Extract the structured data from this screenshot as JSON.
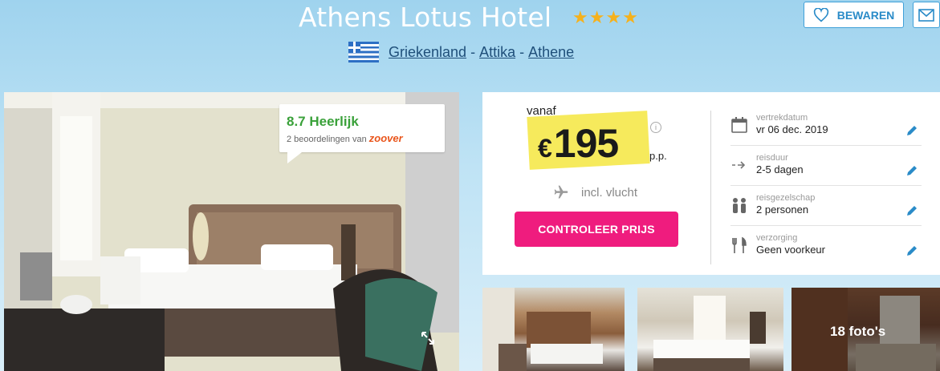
{
  "header": {
    "hotel_name": "Athens Lotus Hotel",
    "star_count": 4,
    "location": {
      "country": "Griekenland",
      "region": "Attika",
      "city": "Athene",
      "separator": "-"
    },
    "save_label": "BEWAREN"
  },
  "rating": {
    "score": "8.7",
    "label": "Heerlijk",
    "reviews_text": "2 beoordelingen van",
    "provider": "zoover"
  },
  "pricing": {
    "from_label": "vanaf",
    "currency": "€",
    "amount": "195",
    "per_person": "p.p.",
    "includes": "incl. vlucht",
    "cta_label": "CONTROLEER PRIJS"
  },
  "details": [
    {
      "label": "vertrekdatum",
      "value": "vr 06 dec. 2019",
      "icon": "calendar-icon"
    },
    {
      "label": "reisduur",
      "value": "2-5 dagen",
      "icon": "duration-arrow-icon"
    },
    {
      "label": "reisgezelschap",
      "value": "2 personen",
      "icon": "people-icon"
    },
    {
      "label": "verzorging",
      "value": "Geen voorkeur",
      "icon": "cutlery-icon"
    }
  ],
  "gallery": {
    "photo_count_label": "18 foto's"
  },
  "colors": {
    "accent_blue": "#2a8bc8",
    "cta_pink": "#ef1c7e",
    "highlight_yellow": "#f5e84a",
    "rating_green": "#3aa13a",
    "star_gold": "#f5b11c"
  }
}
